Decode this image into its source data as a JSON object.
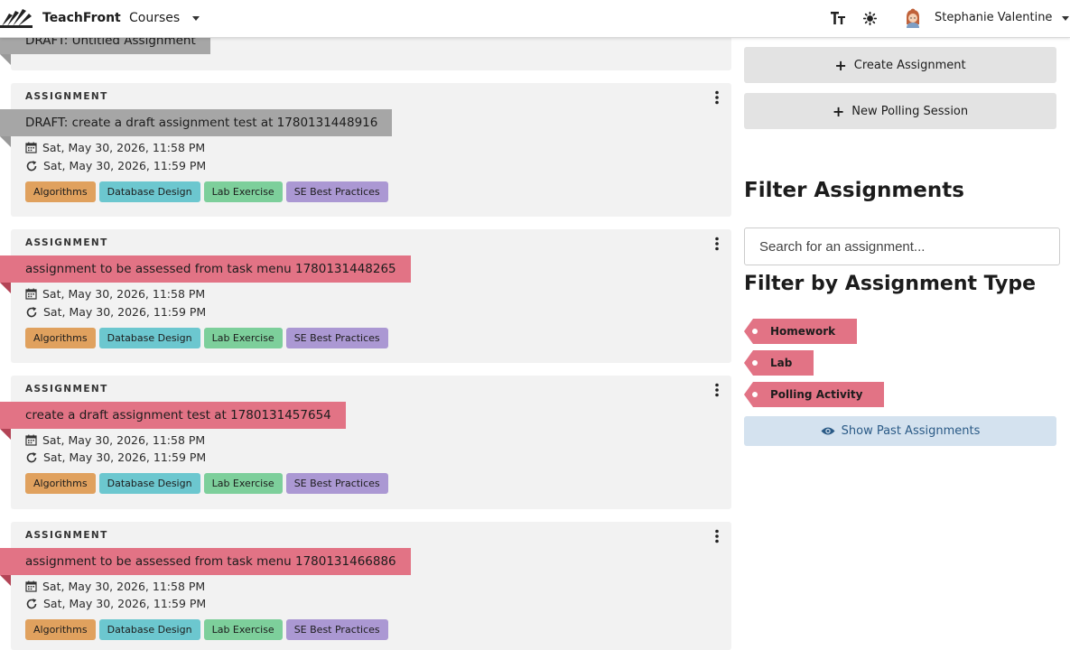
{
  "navbar": {
    "brand": "TeachFront",
    "courses_label": "Courses",
    "user_name": "Stephanie Valentine"
  },
  "partial_card": {
    "title": "DRAFT: Untitled Assignment",
    "ribbon_color": "#a6a6a6"
  },
  "cards": [
    {
      "type": "ASSIGNMENT",
      "title": "DRAFT: create a draft assignment test at 1780131448916",
      "ribbon_color": "#a6a6a6",
      "due": "Sat, May 30, 2026, 11:58 PM",
      "late": "Sat, May 30, 2026, 11:59 PM",
      "tags": [
        "Algorithms",
        "Database Design",
        "Lab Exercise",
        "SE Best Practices"
      ]
    },
    {
      "type": "ASSIGNMENT",
      "title": "assignment to be assessed from task menu 1780131448265",
      "ribbon_color": "#e27385",
      "due": "Sat, May 30, 2026, 11:58 PM",
      "late": "Sat, May 30, 2026, 11:59 PM",
      "tags": [
        "Algorithms",
        "Database Design",
        "Lab Exercise",
        "SE Best Practices"
      ]
    },
    {
      "type": "ASSIGNMENT",
      "title": "create a draft assignment test at 1780131457654",
      "ribbon_color": "#e27385",
      "due": "Sat, May 30, 2026, 11:58 PM",
      "late": "Sat, May 30, 2026, 11:59 PM",
      "tags": [
        "Algorithms",
        "Database Design",
        "Lab Exercise",
        "SE Best Practices"
      ]
    },
    {
      "type": "ASSIGNMENT",
      "title": "assignment to be assessed from task menu 1780131466886",
      "ribbon_color": "#e27385",
      "due": "Sat, May 30, 2026, 11:58 PM",
      "late": "Sat, May 30, 2026, 11:59 PM",
      "tags": [
        "Algorithms",
        "Database Design",
        "Lab Exercise",
        "SE Best Practices"
      ]
    }
  ],
  "tag_colors": {
    "algorithms": "#e0a15e",
    "database_design": "#6cc7cf",
    "lab_exercise": "#7dcf9b",
    "se_best_practices": "#ab98d3"
  },
  "sidebar": {
    "create_assignment": "Create Assignment",
    "new_polling_session": "New Polling Session",
    "filter_heading": "Filter Assignments",
    "search_placeholder": "Search for an assignment...",
    "type_heading": "Filter by Assignment Type",
    "types": [
      "Homework",
      "Lab",
      "Polling Activity"
    ],
    "show_past": "Show Past Assignments"
  },
  "icons": {
    "logo": "teachfront-fan-logo",
    "text_size": "text-size-icon",
    "theme": "sun-gear-icon",
    "calendar": "calendar-icon",
    "refresh": "refresh-icon",
    "kebab": "kebab-menu-icon",
    "plus": "plus-icon",
    "eye": "eye-icon"
  }
}
